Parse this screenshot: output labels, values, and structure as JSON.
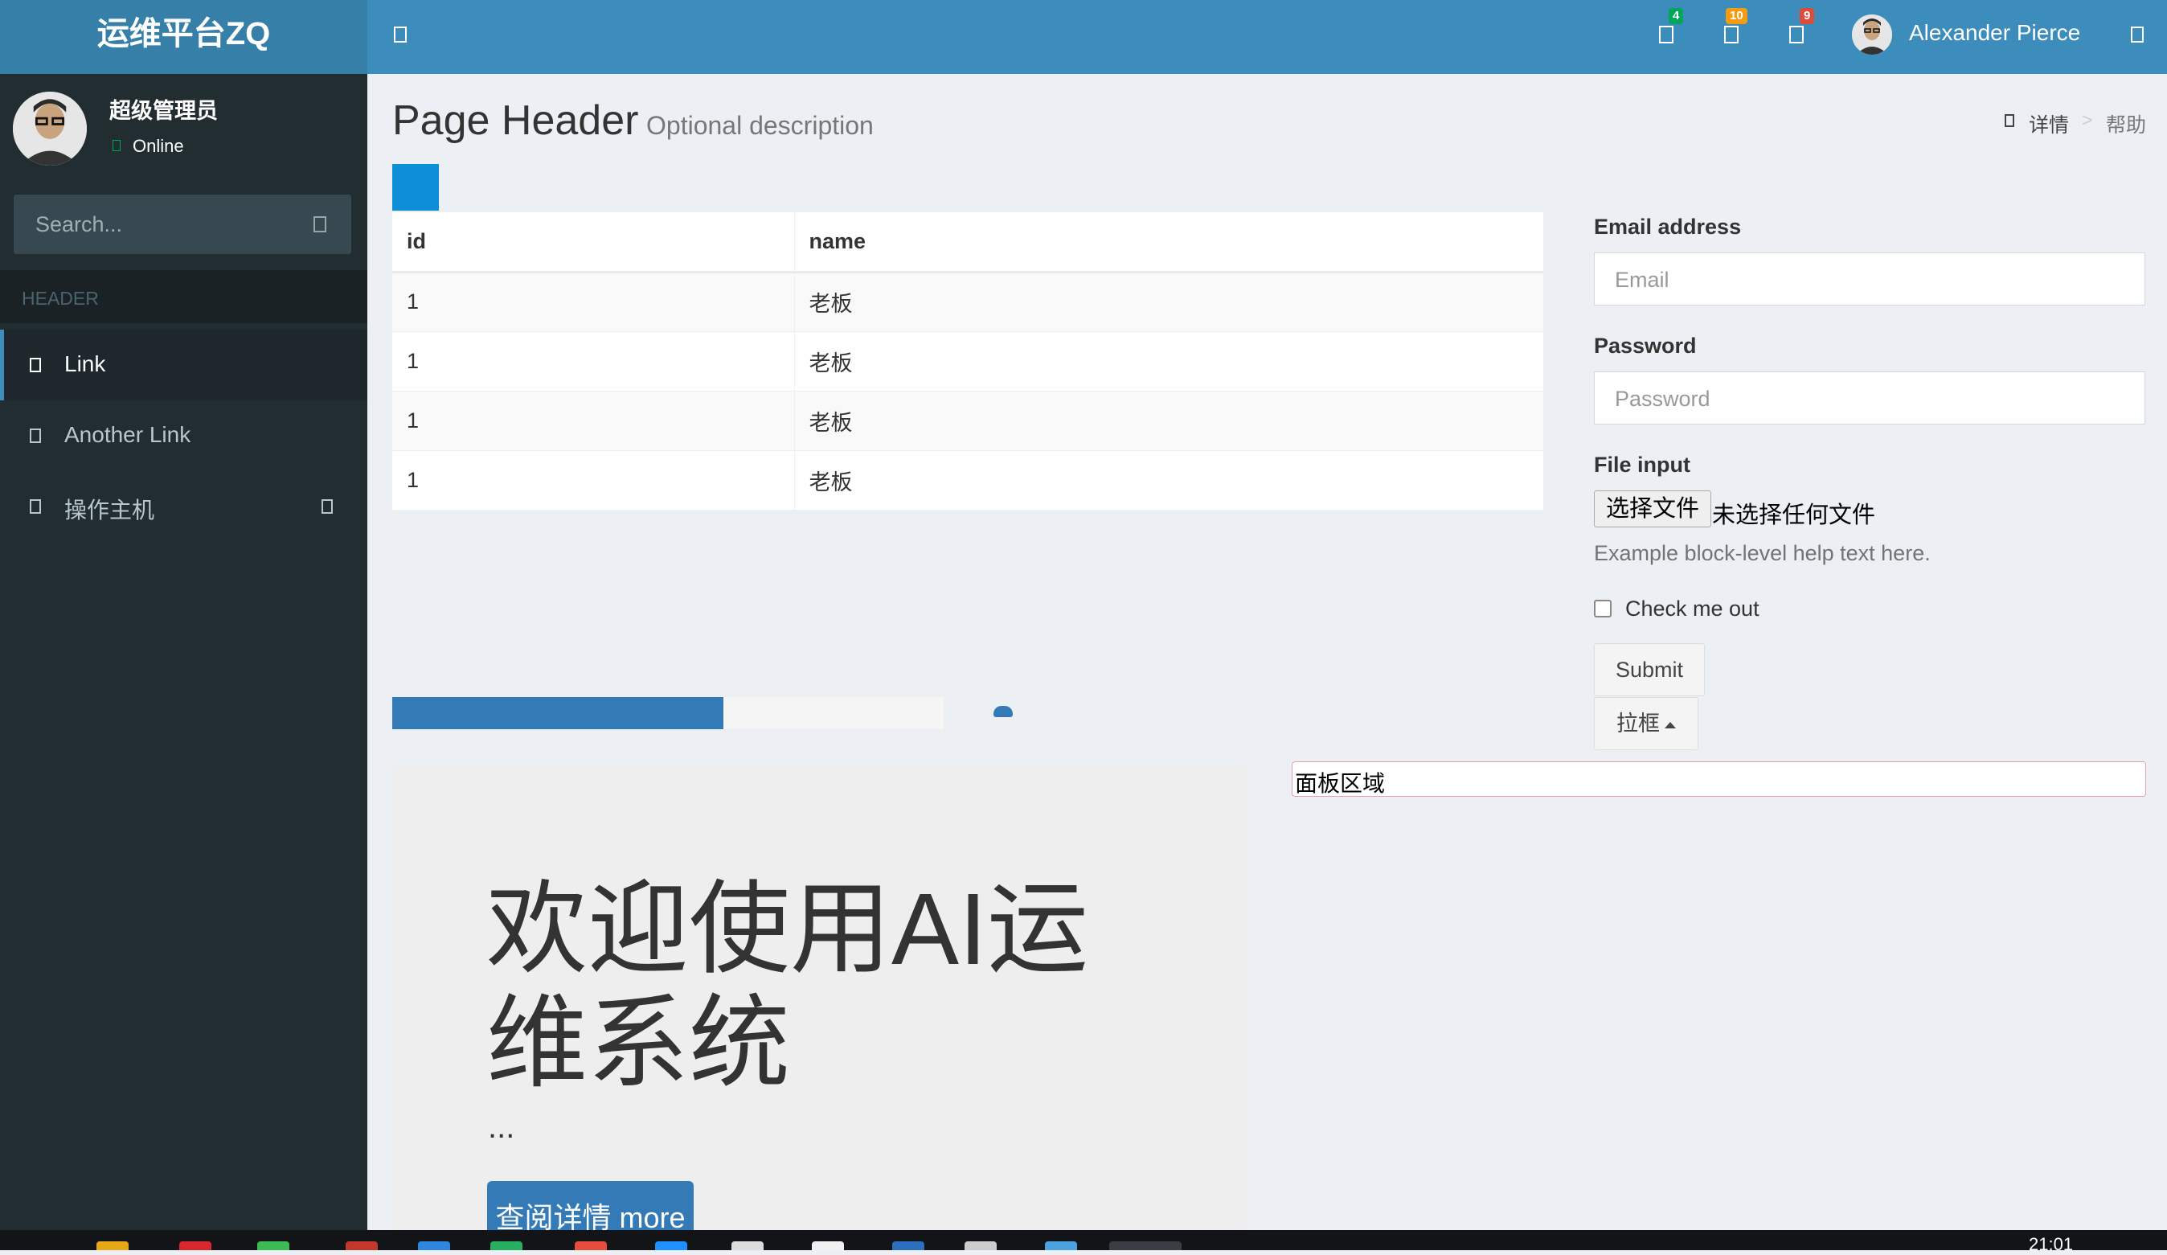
{
  "header": {
    "logo": "运维平台ZQ",
    "notifications": [
      {
        "name": "messages",
        "count": "4",
        "color": "#00a65a"
      },
      {
        "name": "notifications",
        "count": "10",
        "color": "#f39c12"
      },
      {
        "name": "tasks",
        "count": "9",
        "color": "#dd4b39"
      }
    ],
    "user_name": "Alexander Pierce"
  },
  "sidebar": {
    "user": "超级管理员",
    "status": "Online",
    "search_placeholder": "Search...",
    "section_header": "HEADER",
    "items": [
      {
        "label": "Link",
        "active": true
      },
      {
        "label": "Another Link"
      },
      {
        "label": "操作主机"
      }
    ]
  },
  "content": {
    "title": "Page Header",
    "description": "Optional description",
    "breadcrumb": [
      "详情",
      ">",
      "帮助"
    ],
    "table": {
      "headers": [
        "id",
        "name"
      ],
      "rows": [
        [
          "1",
          "老板"
        ],
        [
          "1",
          "老板"
        ],
        [
          "1",
          "老板"
        ],
        [
          "1",
          "老板"
        ]
      ]
    },
    "progress": {
      "value": 0.6,
      "color": "#337ab7"
    }
  },
  "form": {
    "email_label": "Email address",
    "email_placeholder": "Email",
    "password_label": "Password",
    "password_placeholder": "Password",
    "file_label": "File input",
    "file_button": "选择文件",
    "file_none": "未选择任何文件",
    "help": "Example block-level help text here.",
    "checkbox_label": "Check me out",
    "submit": "Submit",
    "dropdown": "拉框"
  },
  "panel": {
    "text": "面板区域"
  },
  "jumbotron": {
    "title": "欢迎使用AI运维系统",
    "dots": "...",
    "button": "查阅详情 more"
  },
  "taskbar": {
    "clock": "21:01"
  }
}
